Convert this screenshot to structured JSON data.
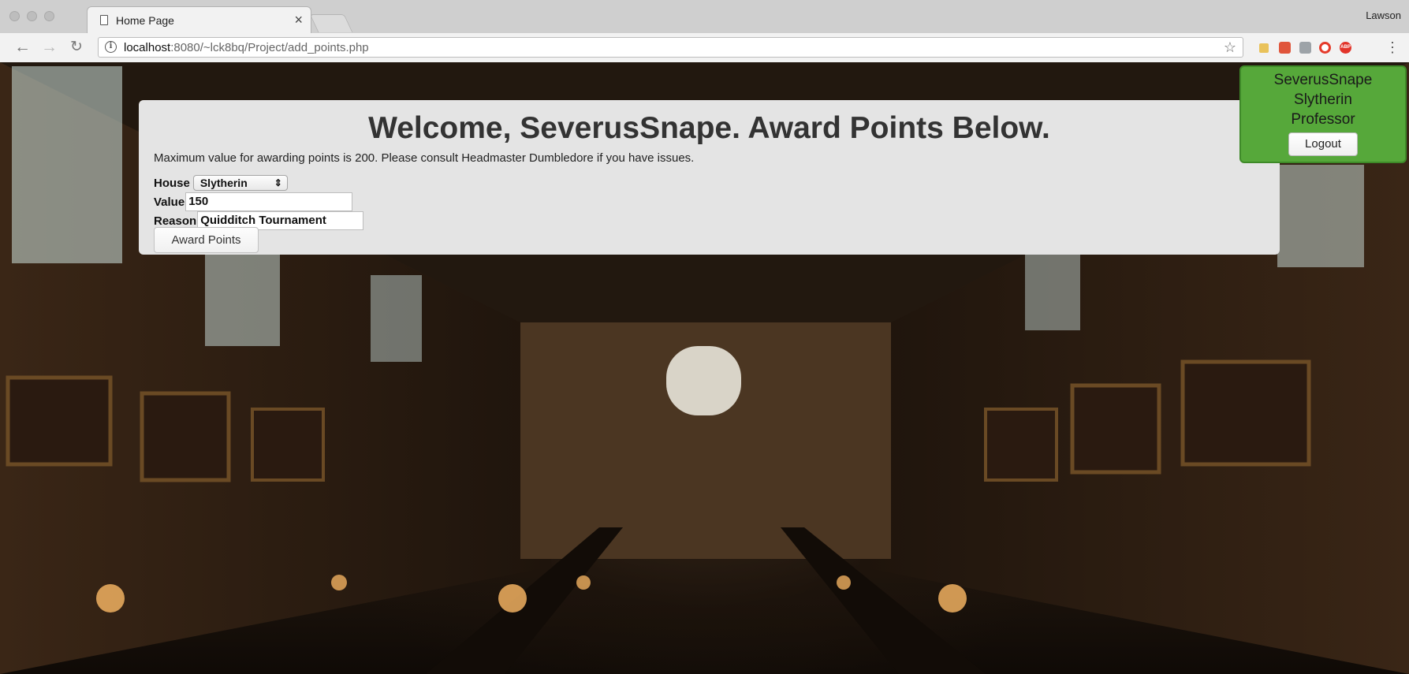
{
  "browser": {
    "tab_title": "Home Page",
    "tab_close": "×",
    "profile_name": "Lawson",
    "url_host": "localhost",
    "url_path": ":8080/~lck8bq/Project/add_points.php",
    "ext_abp_label": "ABP",
    "icons": [
      "back-icon",
      "forward-icon",
      "reload-icon",
      "info-icon",
      "bookmark-star-icon",
      "menu-dots-icon"
    ]
  },
  "page": {
    "heading": "Welcome, SeverusSnape. Award Points Below.",
    "notice": "Maximum value for awarding points is 200. Please consult Headmaster Dumbledore if you have issues.",
    "house_label": "House",
    "house_selected": "Slytherin",
    "value_label": "Value",
    "value_input": "150",
    "reason_label": "Reason",
    "reason_input": "Quidditch Tournament",
    "award_button": "Award Points"
  },
  "user": {
    "name": "SeverusSnape",
    "house": "Slytherin",
    "role": "Professor",
    "logout_label": "Logout",
    "card_color": "#56a83a"
  }
}
